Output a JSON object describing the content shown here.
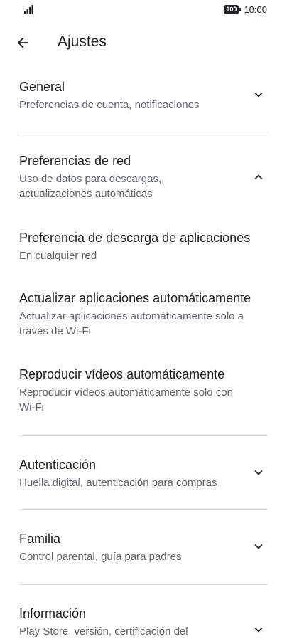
{
  "status_bar": {
    "battery": "100",
    "time": "10:00"
  },
  "header": {
    "title": "Ajustes"
  },
  "sections": {
    "general": {
      "title": "General",
      "subtitle": "Preferencias de cuenta, notificaciones"
    },
    "network": {
      "title": "Preferencias de red",
      "subtitle_line1": "Uso de datos para descargas,",
      "subtitle_line2": "actualizaciones automáticas",
      "items": [
        {
          "title": "Preferencia de descarga de aplicaciones",
          "subtitle_line1": "En cualquier red",
          "subtitle_line2": ""
        },
        {
          "title": "Actualizar aplicaciones automáticamente",
          "subtitle_line1": "Actualizar aplicaciones automáticamente solo a",
          "subtitle_line2": "través de Wi-Fi"
        },
        {
          "title": "Reproducir vídeos automáticamente",
          "subtitle_line1": "Reproducir vídeos automáticamente solo con",
          "subtitle_line2": "Wi-Fi"
        }
      ]
    },
    "authentication": {
      "title": "Autenticación",
      "subtitle": "Huella digital, autenticación para compras"
    },
    "family": {
      "title": "Familia",
      "subtitle": "Control parental, guía para padres"
    },
    "about": {
      "title": "Información",
      "subtitle": "Play Store, versión, certificación del"
    }
  },
  "icons": {
    "back": "arrow-back-icon",
    "expand": "chevron-down-icon",
    "collapse": "chevron-up-icon"
  }
}
